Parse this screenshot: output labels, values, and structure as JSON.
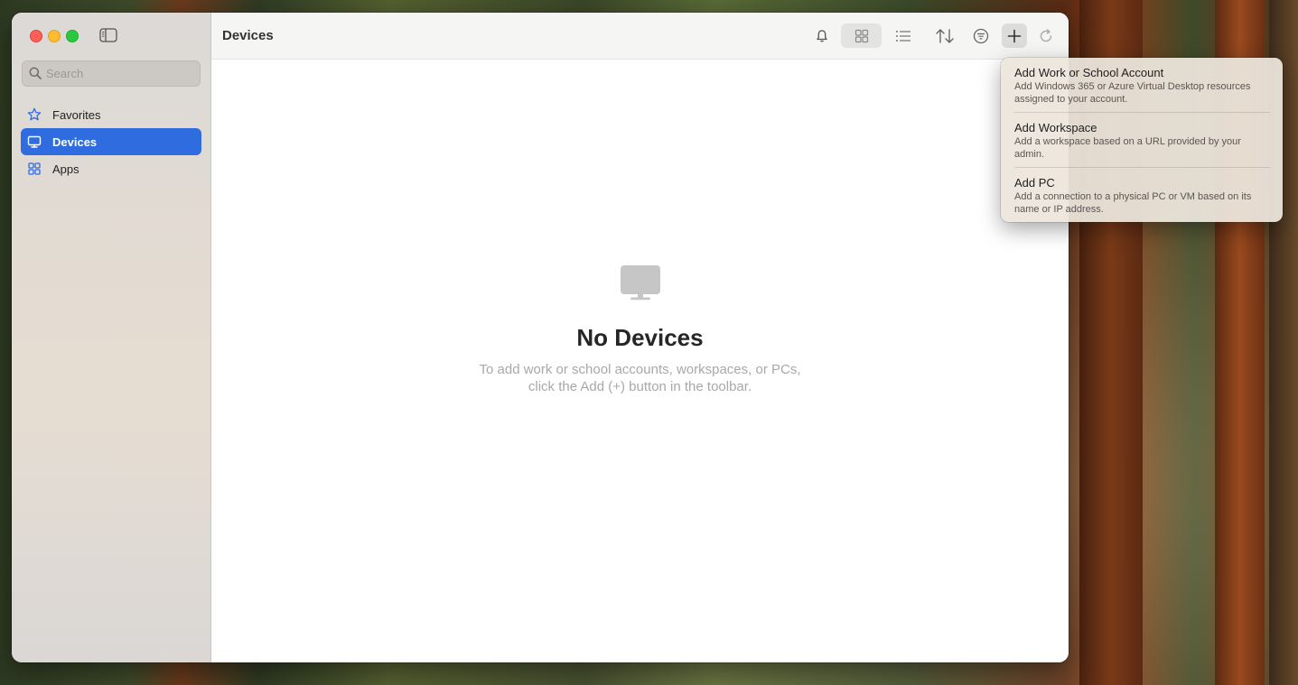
{
  "window": {
    "title": "Devices"
  },
  "sidebar": {
    "search_placeholder": "Search",
    "items": [
      {
        "label": "Favorites",
        "icon": "star-icon",
        "active": false
      },
      {
        "label": "Devices",
        "icon": "monitor-icon",
        "active": true
      },
      {
        "label": "Apps",
        "icon": "apps-grid-icon",
        "active": false
      }
    ]
  },
  "toolbar": {
    "buttons": [
      "bell-icon",
      "grid-view-icon",
      "list-view-icon",
      "sort-icon",
      "filter-icon",
      "plus-icon",
      "refresh-icon"
    ],
    "selected_view": "grid-view-icon"
  },
  "empty_state": {
    "title": "No Devices",
    "line1": "To add work or school accounts, workspaces, or PCs,",
    "line2": "click the Add (+) button in the toolbar."
  },
  "add_menu": {
    "items": [
      {
        "title": "Add Work or School Account",
        "desc1": "Add Windows 365 or Azure Virtual Desktop resources",
        "desc2": "assigned to your account."
      },
      {
        "title": "Add Workspace",
        "desc1": "Add a workspace based on a URL provided by your",
        "desc2": "admin."
      },
      {
        "title": "Add PC",
        "desc1": "Add a connection to a physical PC or VM based on its",
        "desc2": "name or IP address."
      }
    ]
  },
  "colors": {
    "accent": "#2f6ce0",
    "close": "#fe5f57",
    "minimize": "#febc2e",
    "zoom": "#28c840"
  }
}
